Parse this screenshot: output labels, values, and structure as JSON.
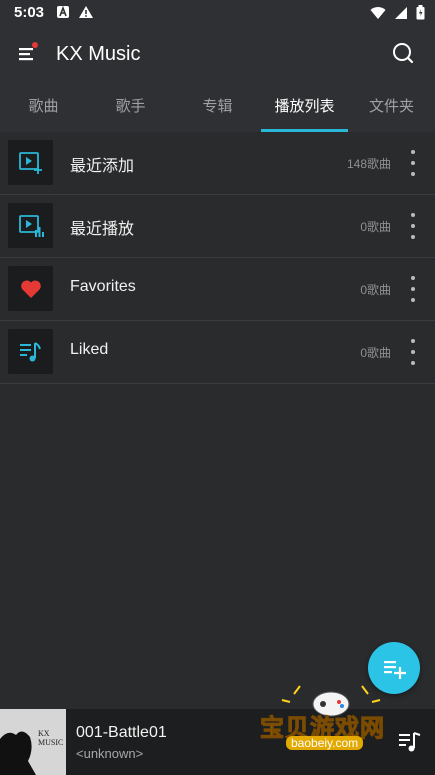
{
  "status_bar": {
    "time": "5:03"
  },
  "app": {
    "title": "KX Music"
  },
  "tabs": [
    {
      "label": "歌曲"
    },
    {
      "label": "歌手"
    },
    {
      "label": "专辑"
    },
    {
      "label": "播放列表"
    },
    {
      "label": "文件夹"
    }
  ],
  "playlists": [
    {
      "name": "最近添加",
      "count": "148歌曲",
      "icon": "recent-add-icon"
    },
    {
      "name": "最近播放",
      "count": "0歌曲",
      "icon": "recent-play-icon"
    },
    {
      "name": "Favorites",
      "count": "0歌曲",
      "icon": "heart-icon"
    },
    {
      "name": "Liked",
      "count": "0歌曲",
      "icon": "music-list-icon"
    }
  ],
  "now_playing": {
    "title": "001-Battle01",
    "artist": "<unknown>",
    "cover_text_line1": "KX",
    "cover_text_line2": "MUSIC"
  },
  "watermark": {
    "title": "宝贝游戏网",
    "url": "baobeiy.com"
  },
  "colors": {
    "accent": "#2bb7d8",
    "fab": "#2bc3e6",
    "heart": "#e53935"
  }
}
